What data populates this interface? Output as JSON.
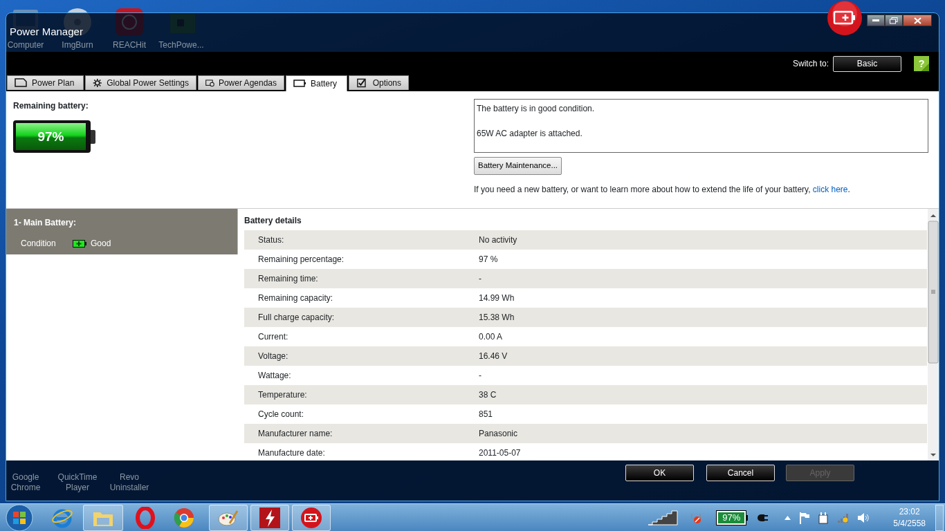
{
  "desktop_icons": [
    {
      "label": "Computer"
    },
    {
      "label": "ImgBurn"
    },
    {
      "label": "REACHit"
    },
    {
      "label": "TechPowe..."
    },
    {
      "label": "Google Chrome"
    },
    {
      "label": "QuickTime Player"
    },
    {
      "label": "Revo Uninstaller"
    }
  ],
  "window": {
    "title": "Power Manager",
    "switch_label": "Switch to:",
    "switch_button": "Basic",
    "help_icon": "?"
  },
  "tabs": [
    {
      "label": "Power Plan",
      "selected": false
    },
    {
      "label": "Global Power Settings",
      "selected": false
    },
    {
      "label": "Power Agendas",
      "selected": false
    },
    {
      "label": "Battery",
      "selected": true
    },
    {
      "label": "Options",
      "selected": false
    }
  ],
  "remaining": {
    "label": "Remaining battery:",
    "level": 0.97,
    "reading": "97%"
  },
  "messages": [
    "The battery is in good condition.",
    "65W AC adapter is attached."
  ],
  "maintenance_button": "Battery Maintenance...",
  "help": {
    "text": "If you need a new battery, or want to learn more about how to extend the life of your battery,",
    "link": "click here",
    "after": "."
  },
  "battery_panel": {
    "title": "1- Main Battery:",
    "condition_label": "Condition",
    "condition_value": "Good"
  },
  "details": {
    "title": "Battery details",
    "rows": [
      {
        "label": "Status:",
        "value": "No activity"
      },
      {
        "label": "Remaining percentage:",
        "value": "97 %"
      },
      {
        "label": "Remaining time:",
        "value": "-"
      },
      {
        "label": "Remaining capacity:",
        "value": "14.99 Wh"
      },
      {
        "label": "Full charge capacity:",
        "value": "15.38 Wh"
      },
      {
        "label": "Current:",
        "value": "0.00 A"
      },
      {
        "label": "Voltage:",
        "value": "16.46 V"
      },
      {
        "label": "Wattage:",
        "value": "-"
      },
      {
        "label": "Temperature:",
        "value": "38 C"
      },
      {
        "label": "Cycle count:",
        "value": "851"
      },
      {
        "label": "Manufacturer name:",
        "value": "Panasonic"
      },
      {
        "label": "Manufacture date:",
        "value": "2011-05-07"
      }
    ]
  },
  "buttons": [
    {
      "label": "OK",
      "disabled": false
    },
    {
      "label": "Cancel",
      "disabled": false
    },
    {
      "label": "Apply",
      "disabled": true
    }
  ],
  "taskbar": {
    "battery_reading": "97%",
    "time": "23:02",
    "date": "5/4/2558"
  }
}
